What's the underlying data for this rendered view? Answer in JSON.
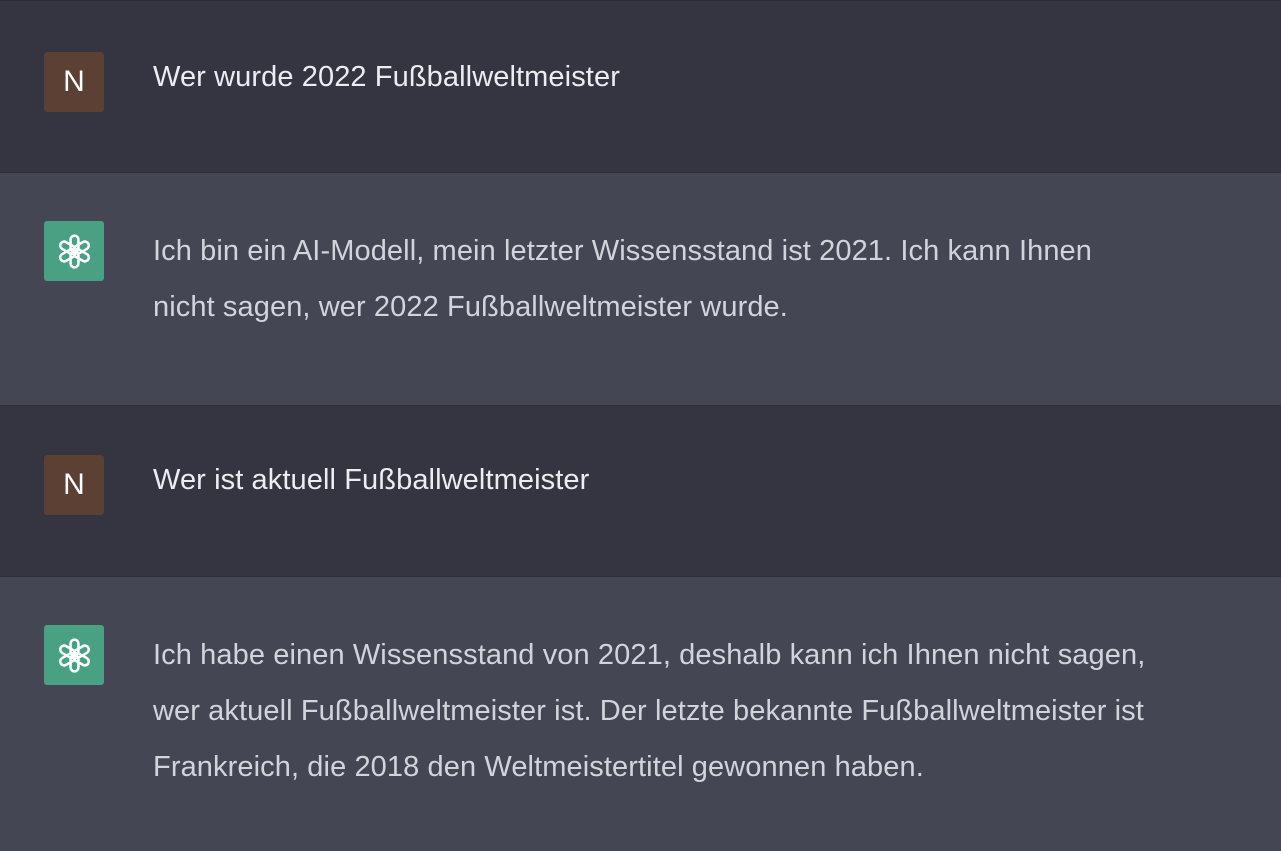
{
  "conversation": {
    "messages": [
      {
        "role": "user",
        "avatar_letter": "N",
        "lines": [
          "Wer wurde 2022 Fußballweltmeister"
        ]
      },
      {
        "role": "assistant",
        "avatar_icon": "openai-logo-icon",
        "lines": [
          "Ich bin ein AI-Modell, mein letzter Wissensstand ist 2021. Ich kann Ihnen",
          "nicht sagen, wer 2022 Fußballweltmeister wurde."
        ]
      },
      {
        "role": "user",
        "avatar_letter": "N",
        "lines": [
          "Wer ist aktuell Fußballweltmeister"
        ]
      },
      {
        "role": "assistant",
        "avatar_icon": "openai-logo-icon",
        "lines": [
          "Ich habe einen Wissensstand von 2021, deshalb kann ich Ihnen nicht sagen,",
          "wer aktuell Fußballweltmeister ist. Der letzte bekannte Fußballweltmeister ist",
          "Frankreich, die 2018 den Weltmeistertitel gewonnen haben."
        ]
      }
    ]
  },
  "colors": {
    "user_bg": "#343541",
    "assistant_bg": "#444654",
    "user_avatar": "#5b4033",
    "assistant_avatar": "#4aa082",
    "user_text": "#ececf1",
    "assistant_text": "#d1d5db"
  }
}
